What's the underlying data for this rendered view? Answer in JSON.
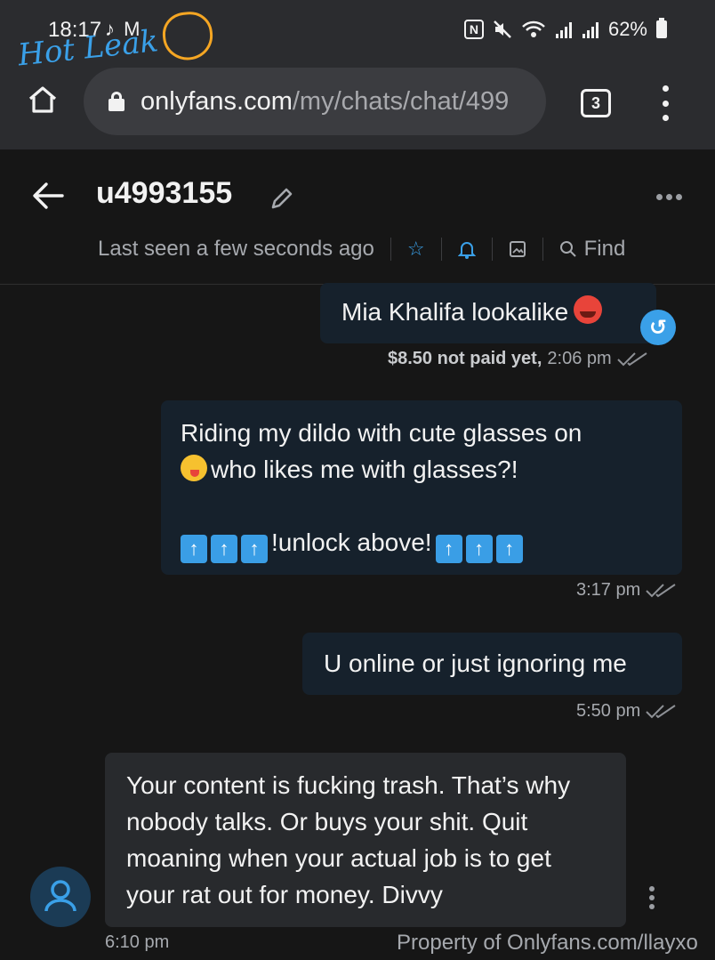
{
  "status_bar": {
    "time": "18:17",
    "notification_icons": "♪ M",
    "battery": "62%",
    "watermark_logo": "Hot Leak",
    "icons": [
      "nfc-icon",
      "mute-icon",
      "wifi-icon",
      "signal-icon",
      "signal-icon",
      "battery-icon"
    ]
  },
  "browser": {
    "url_domain": "onlyfans.com",
    "url_path": "/my/chats/chat/499",
    "tab_count": "3"
  },
  "chat": {
    "username": "u4993155",
    "last_seen": "Last seen a few seconds ago",
    "find_label": "Find"
  },
  "messages": [
    {
      "direction": "out",
      "text": "Mia Khalifa lookalike",
      "price": "$8.50 not paid yet,",
      "time": "2:06 pm"
    },
    {
      "direction": "out",
      "line1": "Riding my dildo with cute glasses on",
      "line2": "who likes me with glasses?!",
      "line3": "!unlock above!",
      "time": "3:17 pm"
    },
    {
      "direction": "out",
      "text": "U online or just ignoring me",
      "time": "5:50 pm"
    },
    {
      "direction": "in",
      "text": "Your content is fucking trash. That’s why nobody talks. Or buys your shit. Quit moaning when your actual job is to get your rat out for money. Divvy",
      "time": "6:10 pm"
    }
  ],
  "watermark_text": "Property of Onlyfans.com/llayxo",
  "colors": {
    "accent": "#3aa0e8",
    "background": "#161616",
    "browser_bar": "#2b2c2f",
    "outgoing_bubble": "#16212c",
    "incoming_bubble": "#282a2d"
  }
}
